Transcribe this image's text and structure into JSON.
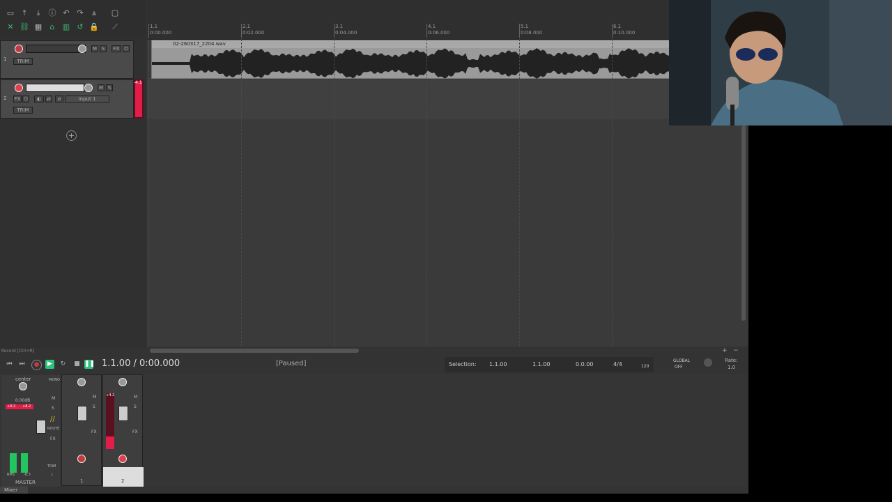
{
  "ruler": {
    "marks": [
      {
        "bar": "1.1",
        "time": "0:00.000"
      },
      {
        "bar": "2.1",
        "time": "0:02.000"
      },
      {
        "bar": "3.1",
        "time": "0:04.000"
      },
      {
        "bar": "4.1",
        "time": "0:06.000"
      },
      {
        "bar": "5.1",
        "time": "0:08.000"
      },
      {
        "bar": "6.1",
        "time": "0:10.000"
      }
    ]
  },
  "media_item": {
    "name": "02-260317_2204.wav"
  },
  "tracks": [
    {
      "number": "1",
      "mute": "M",
      "solo": "S",
      "fx": "FX",
      "trim": "TRIM"
    },
    {
      "number": "2",
      "mute": "M",
      "solo": "S",
      "fx": "FX",
      "input": "Input 1",
      "trim": "TRIM",
      "meter_peak": "-4.1"
    }
  ],
  "tcp": {
    "add_track_icon": "plus-circle-icon",
    "record_hint": "Record [Ctrl+R]"
  },
  "transport": {
    "position": "1.1.00 / 0:00.000",
    "status": "[Paused]",
    "selection_label": "Selection:",
    "selection_start": "1.1.00",
    "selection_end": "1.1.00",
    "selection_length": "0.0.00",
    "time_sig": "4/4",
    "bpm": "120",
    "global_label": "GLOBAL",
    "global_state": "OFF",
    "rate_label": "Rate:",
    "rate_value": "1.0"
  },
  "master": {
    "pan_label": "center",
    "volume": "0.00dB",
    "peak": "+0.2",
    "peak2": "+8.2",
    "mono": "MONO",
    "m": "M",
    "s": "S",
    "route": "ROUTE",
    "fx": "FX",
    "trim": "TRIM",
    "rms_label": "RMS",
    "rms_value": "-8.3",
    "label": "MASTER"
  },
  "mixer_strips": [
    {
      "number": "1",
      "m": "M",
      "s": "S",
      "fx": "FX"
    },
    {
      "number": "2",
      "m": "M",
      "s": "S",
      "fx": "FX",
      "peak": "+4.2"
    }
  ],
  "mixer_tab": {
    "label": "Mixer"
  },
  "colors": {
    "accent_red": "#c03a40",
    "meter_green": "#22c55e",
    "meter_pink": "#e11d48",
    "play_green": "#2ec27e"
  }
}
